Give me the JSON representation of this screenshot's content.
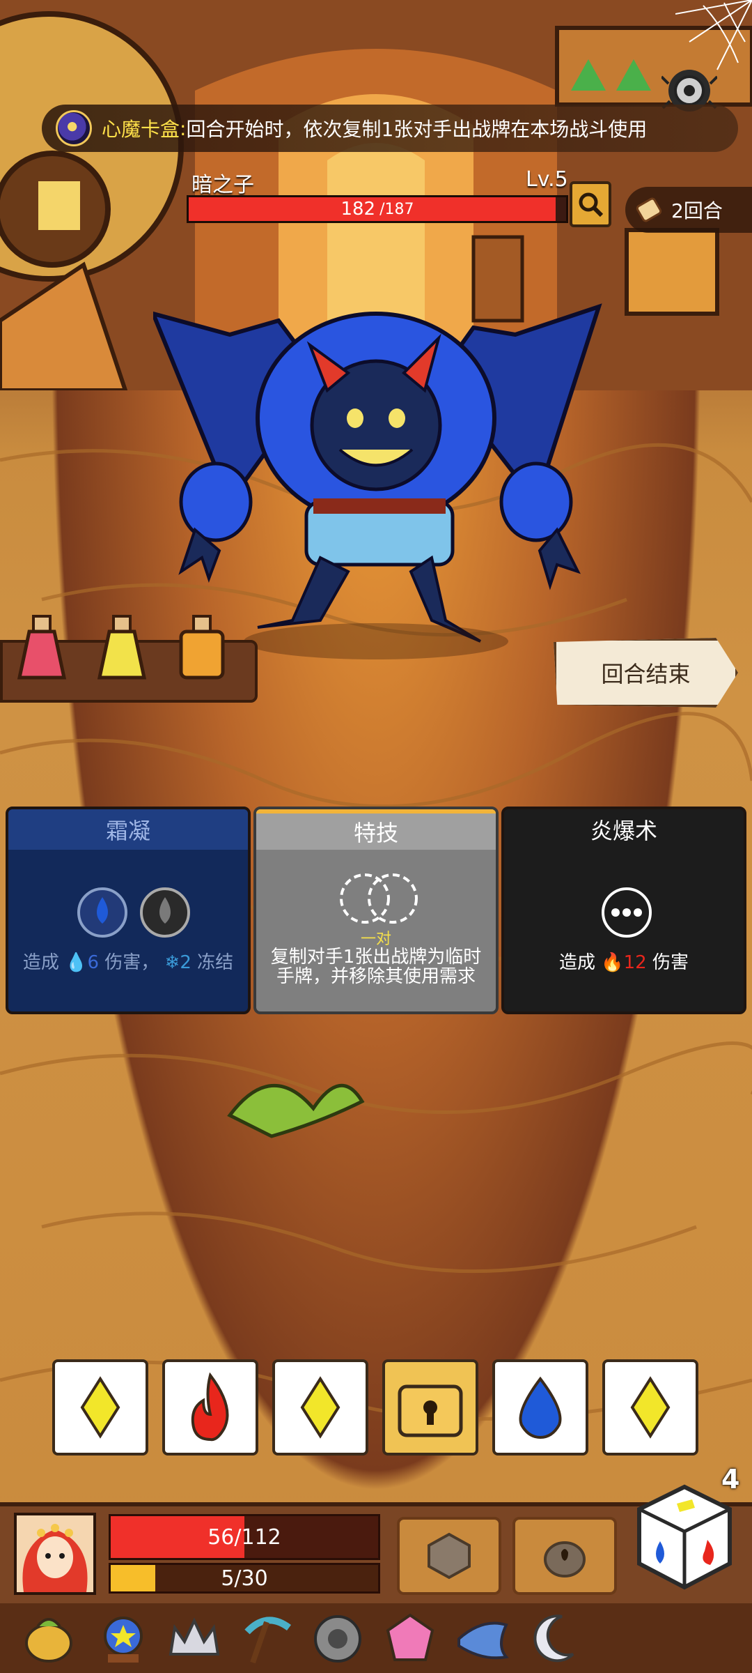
{
  "relic": {
    "name": "心魔卡盒",
    "separator": ":",
    "description": "回合开始时，依次复制1张对手出战牌在本场战斗使用"
  },
  "enemy": {
    "name": "暗之子",
    "level": "Lv.5",
    "hp_current": "182",
    "hp_max": "/187",
    "hp_fraction": 0.973
  },
  "round": {
    "label": "2回合"
  },
  "end_turn": {
    "label": "回合结束"
  },
  "potions": [
    {
      "name": "pink-potion",
      "color": "#e8506a"
    },
    {
      "name": "yellow-potion",
      "color": "#f2e24a"
    },
    {
      "name": "orange-potion",
      "color": "#f0a332"
    }
  ],
  "cards": [
    {
      "title": "霜凝",
      "desc_prefix": "造成",
      "damage": "6",
      "desc_mid": "伤害，",
      "freeze": "2",
      "desc_suffix": "冻结"
    },
    {
      "title": "特技",
      "pair_label": "一对",
      "description": "复制对手1张出战牌为临时手牌，并移除其使用需求"
    },
    {
      "title": "炎爆术",
      "desc_prefix": "造成",
      "damage": "12",
      "desc_suffix": "伤害"
    }
  ],
  "dice": [
    {
      "face": "yellow-diamond-icon"
    },
    {
      "face": "red-flame-icon"
    },
    {
      "face": "yellow-diamond-icon"
    },
    {
      "face": "lock-icon"
    },
    {
      "face": "blue-drop-icon"
    },
    {
      "face": "yellow-diamond-icon"
    }
  ],
  "dice_remaining": "4",
  "player": {
    "hp_text": "56/112",
    "hp_fraction": 0.5,
    "energy_text": "5/30",
    "energy_fraction": 0.167
  },
  "colors": {
    "hp_red": "#f0302a",
    "energy_yellow": "#f7be2a",
    "relic_name_yellow": "#ffe14a",
    "fire": "#e8261c",
    "water": "#1f5ad8",
    "diamond": "#f2e62a"
  }
}
